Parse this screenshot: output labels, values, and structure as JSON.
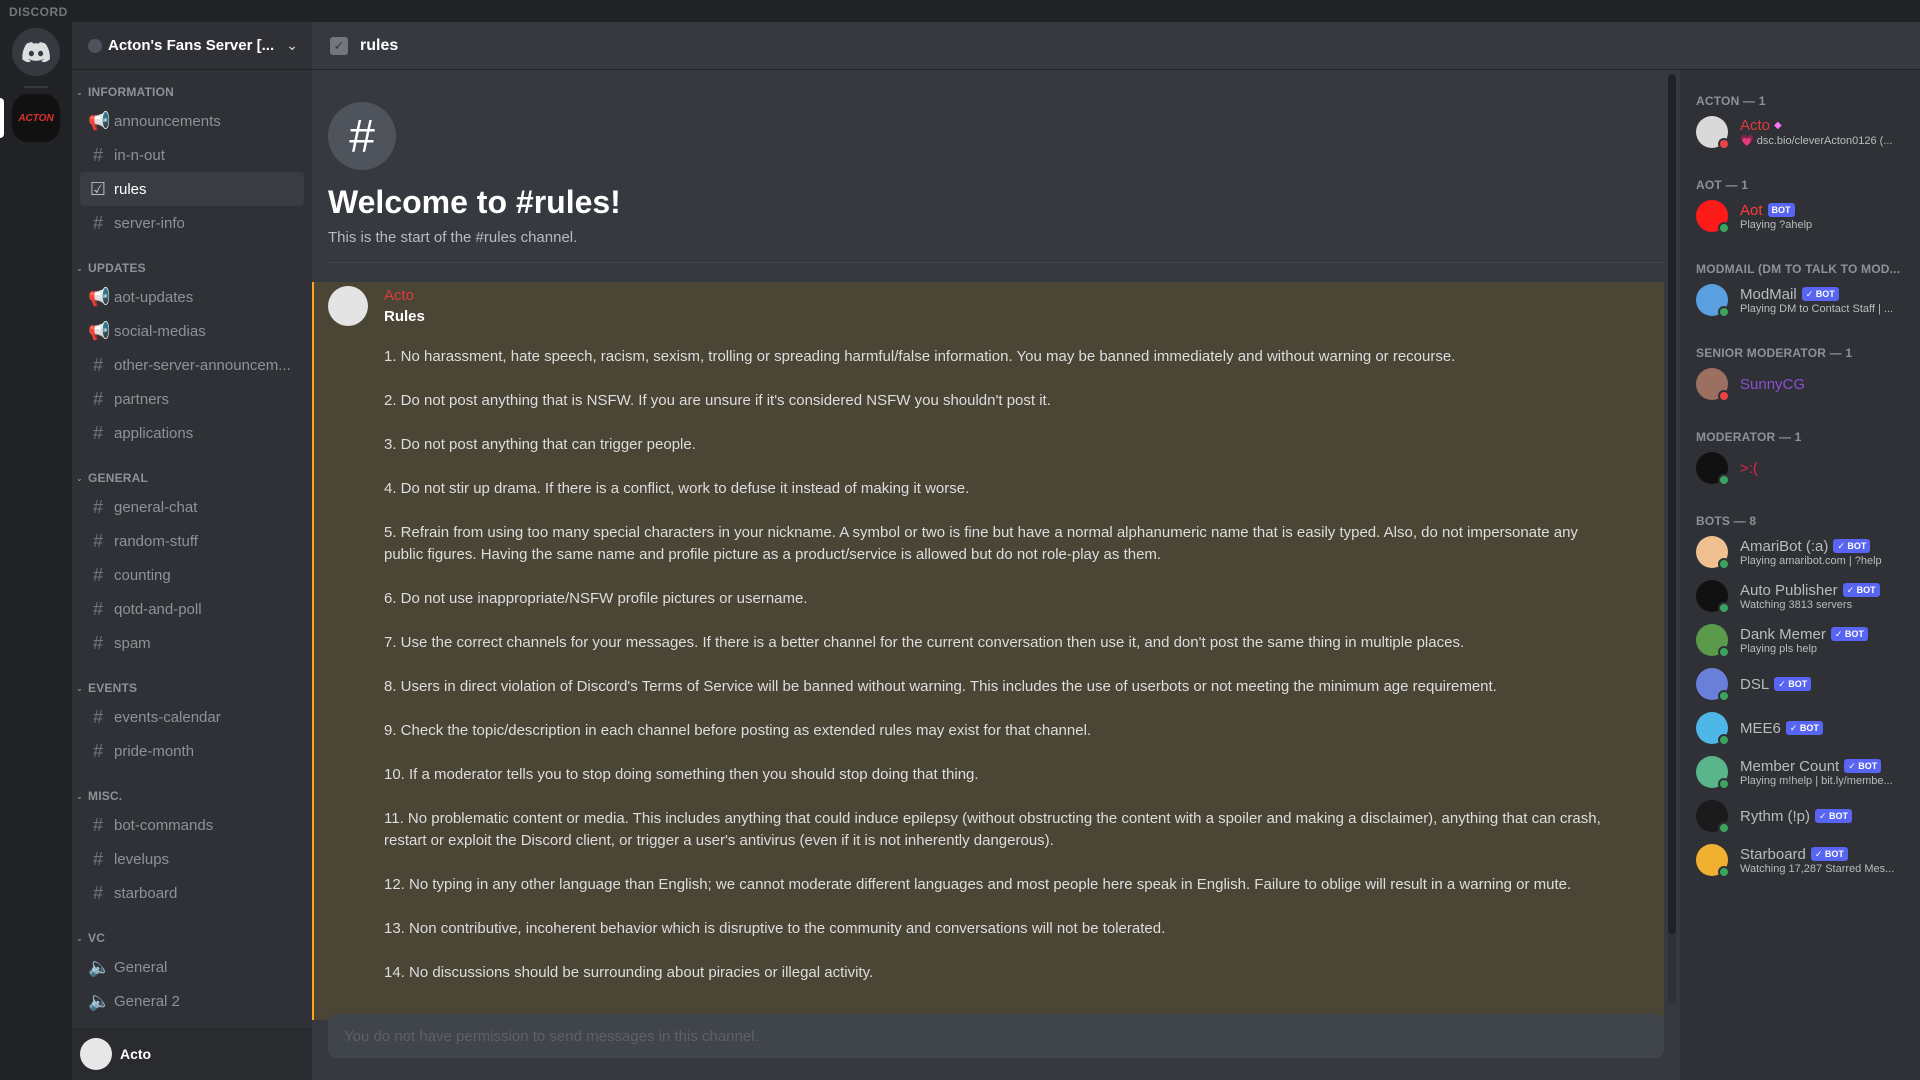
{
  "app": {
    "brand": "DISCORD"
  },
  "rail": {
    "server_label": "ACTON"
  },
  "server": {
    "name": "Acton's Fans Server [..."
  },
  "categories": [
    {
      "name": "INFORMATION",
      "channels": [
        {
          "name": "announcements",
          "icon": "megaphone-icon",
          "glyph": "📢"
        },
        {
          "name": "in-n-out",
          "icon": "hash-icon",
          "glyph": "#"
        },
        {
          "name": "rules",
          "icon": "rules-icon",
          "glyph": "☑",
          "active": true
        },
        {
          "name": "server-info",
          "icon": "hash-icon",
          "glyph": "#"
        }
      ]
    },
    {
      "name": "UPDATES",
      "channels": [
        {
          "name": "aot-updates",
          "icon": "megaphone-icon",
          "glyph": "📢"
        },
        {
          "name": "social-medias",
          "icon": "megaphone-icon",
          "glyph": "📢"
        },
        {
          "name": "other-server-announcem...",
          "icon": "hash-icon",
          "glyph": "#"
        },
        {
          "name": "partners",
          "icon": "hash-icon",
          "glyph": "#"
        },
        {
          "name": "applications",
          "icon": "hash-icon",
          "glyph": "#"
        }
      ]
    },
    {
      "name": "GENERAL",
      "channels": [
        {
          "name": "general-chat",
          "icon": "hash-icon",
          "glyph": "#"
        },
        {
          "name": "random-stuff",
          "icon": "hash-icon",
          "glyph": "#"
        },
        {
          "name": "counting",
          "icon": "hash-icon",
          "glyph": "#"
        },
        {
          "name": "qotd-and-poll",
          "icon": "hash-icon",
          "glyph": "#"
        },
        {
          "name": "spam",
          "icon": "hash-icon",
          "glyph": "#"
        }
      ]
    },
    {
      "name": "EVENTS",
      "channels": [
        {
          "name": "events-calendar",
          "icon": "hash-icon",
          "glyph": "#"
        },
        {
          "name": "pride-month",
          "icon": "hash-icon",
          "glyph": "#"
        }
      ]
    },
    {
      "name": "MISC.",
      "channels": [
        {
          "name": "bot-commands",
          "icon": "hash-icon",
          "glyph": "#"
        },
        {
          "name": "levelups",
          "icon": "hash-icon",
          "glyph": "#"
        },
        {
          "name": "starboard",
          "icon": "hash-icon",
          "glyph": "#"
        }
      ]
    },
    {
      "name": "VC",
      "channels": [
        {
          "name": "General",
          "icon": "speaker-icon",
          "glyph": "🔈"
        },
        {
          "name": "General 2",
          "icon": "speaker-icon",
          "glyph": "🔈"
        }
      ]
    }
  ],
  "user": {
    "name": "Acto"
  },
  "channel": {
    "name": "rules"
  },
  "welcome": {
    "title": "Welcome to #rules!",
    "subtitle": "This is the start of the #rules channel."
  },
  "message": {
    "author": "Acto",
    "subject": "Rules",
    "rules": [
      "1. No harassment, hate speech, racism, sexism, trolling or spreading harmful/false information. You may be banned immediately and without warning or recourse.",
      "2. Do not post anything that is NSFW. If you are unsure if it's considered NSFW you shouldn't post it.",
      "3. Do not post anything that can trigger people.",
      "4. Do not stir up drama. If there is a conflict, work to defuse it instead of making it worse.",
      "5. Refrain from using too many special characters in your nickname. A symbol or two is fine but have a normal alphanumeric name that is easily typed. Also, do not impersonate any public figures. Having the same name and profile picture as a product/service is allowed but do not role-play as them.",
      "6. Do not use inappropriate/NSFW profile pictures or username.",
      "7. Use the correct channels for your messages. If there is a better channel for the current conversation then use it, and don't post the same thing in multiple places.",
      "8. Users in direct violation of Discord's Terms of Service will be banned without warning. This includes the use of userbots or not meeting the minimum age requirement.",
      "9. Check the topic/description in each channel before posting as extended rules may exist for that channel.",
      "10. If a moderator tells you to stop doing something then you should stop doing that thing.",
      "11. No problematic content or media. This includes anything that could induce epilepsy (without obstructing the content with a spoiler and making a disclaimer), anything that can crash, restart or exploit the Discord client, or trigger a user's antivirus (even if it is not inherently dangerous).",
      "12. No typing in any other language than English; we cannot moderate different languages and most people here speak in English. Failure to oblige will result in a warning or mute.",
      "13. Non contributive, incoherent behavior which is disruptive to the community and conversations will not be tolerated.",
      "14. No discussions should be surrounding about piracies or illegal activity."
    ]
  },
  "composer": {
    "placeholder": "You do not have permission to send messages in this channel."
  },
  "member_groups": [
    {
      "role": "ACTON — 1",
      "members": [
        {
          "name": "Acto",
          "color": "#e03b3b",
          "activity": "💗 dsc.bio/cleverActon0126 (...",
          "status": "#ed4245",
          "avatar": "#d9d9d9",
          "badge": "◆"
        }
      ]
    },
    {
      "role": "AOT — 1",
      "members": [
        {
          "name": "Aot",
          "color": "#ff3b3b",
          "bot": "BOT",
          "activity": "Playing ?ahelp",
          "status": "#3ba55d",
          "avatar": "#ff1a1a"
        }
      ]
    },
    {
      "role": "MODMAIL (DM TO TALK TO MOD...",
      "members": [
        {
          "name": "ModMail",
          "color": "#b9bbbe",
          "bot": "✓ BOT",
          "activity": "Playing DM to Contact Staff | ...",
          "status": "#3ba55d",
          "avatar": "#5aa0e0"
        }
      ]
    },
    {
      "role": "SENIOR MODERATOR — 1",
      "members": [
        {
          "name": "SunnyCG",
          "color": "#8a4fd1",
          "activity": "",
          "status": "#ed4245",
          "avatar": "#9b7060"
        }
      ]
    },
    {
      "role": "MODERATOR — 1",
      "members": [
        {
          "name": ">:(",
          "color": "#e8204a",
          "activity": "",
          "status": "#3ba55d",
          "avatar": "#111111"
        }
      ]
    },
    {
      "role": "BOTS — 8",
      "members": [
        {
          "name": "AmariBot (:a)",
          "color": "#b9bbbe",
          "bot": "✓ BOT",
          "activity": "Playing amaribot.com | ?help",
          "status": "#3ba55d",
          "avatar": "#f0c090"
        },
        {
          "name": "Auto Publisher",
          "color": "#b9bbbe",
          "bot": "✓ BOT",
          "activity": "Watching 3813 servers",
          "status": "#3ba55d",
          "avatar": "#111111"
        },
        {
          "name": "Dank Memer",
          "color": "#b9bbbe",
          "bot": "✓ BOT",
          "activity": "Playing pls help",
          "status": "#3ba55d",
          "avatar": "#5a9a4a"
        },
        {
          "name": "DSL",
          "color": "#b9bbbe",
          "bot": "✓ BOT",
          "activity": "",
          "status": "#3ba55d",
          "avatar": "#6a7fd8"
        },
        {
          "name": "MEE6",
          "color": "#b9bbbe",
          "bot": "✓ BOT",
          "activity": "",
          "status": "#3ba55d",
          "avatar": "#4fb6e8"
        },
        {
          "name": "Member Count",
          "color": "#b9bbbe",
          "bot": "✓ BOT",
          "activity": "Playing m!help | bit.ly/membe...",
          "status": "#3ba55d",
          "avatar": "#5ab58a"
        },
        {
          "name": "Rythm (!p)",
          "color": "#b9bbbe",
          "bot": "✓ BOT",
          "activity": "",
          "status": "#3ba55d",
          "avatar": "#1a1a1a"
        },
        {
          "name": "Starboard",
          "color": "#b9bbbe",
          "bot": "✓ BOT",
          "activity": "Watching 17,287 Starred Mes...",
          "status": "#3ba55d",
          "avatar": "#f0b030"
        }
      ]
    }
  ]
}
